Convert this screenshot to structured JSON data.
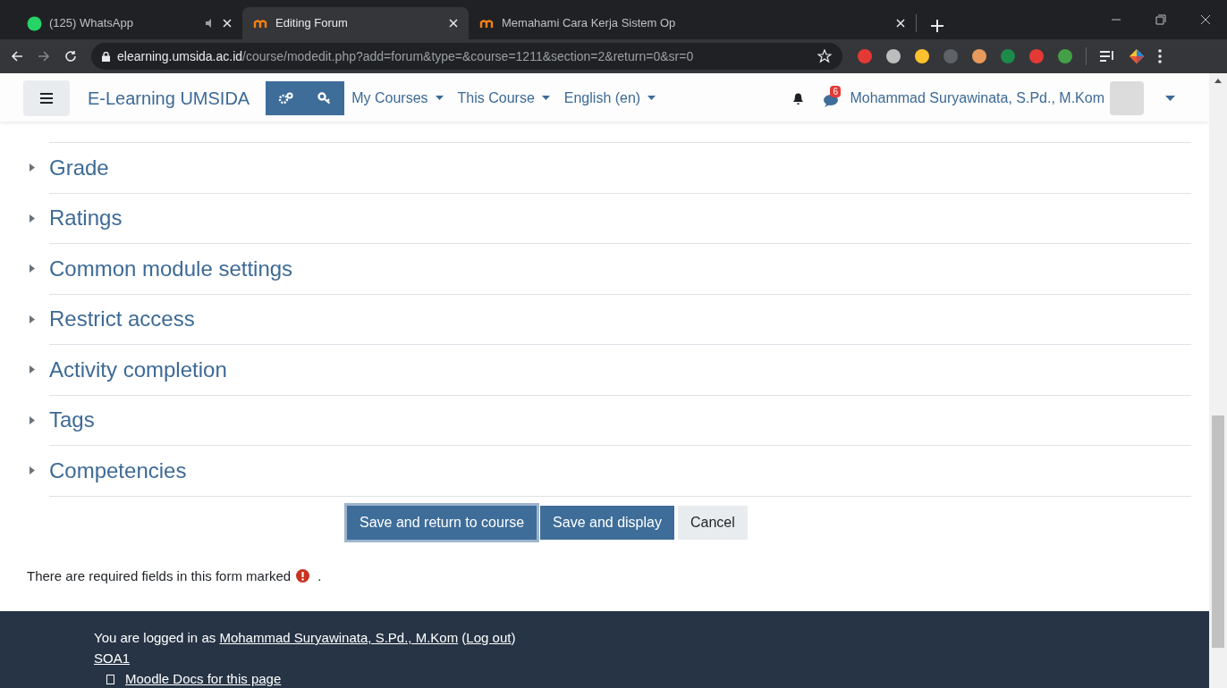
{
  "browser": {
    "tabs": [
      {
        "title": "(125) WhatsApp",
        "selected": false,
        "kind": "whatsapp",
        "muted": true
      },
      {
        "title": "Editing Forum",
        "selected": true,
        "kind": "moodle",
        "muted": false
      },
      {
        "title": "Memahami Cara Kerja Sistem Op",
        "selected": false,
        "kind": "moodle",
        "muted": false
      }
    ],
    "address": {
      "domain": "elearning.umsida.ac.id",
      "path": "/course/modedit.php?add=forum&type=&course=1211&section=2&return=0&sr=0"
    }
  },
  "navbar": {
    "brand": "E-Learning UMSIDA",
    "menus": [
      "My Courses",
      "This Course",
      "English (en)"
    ],
    "message_count": "6",
    "user": "Mohammad Suryawinata, S.Pd., M.Kom"
  },
  "sections": [
    {
      "label": "Grade",
      "expanded": false
    },
    {
      "label": "Ratings",
      "expanded": false
    },
    {
      "label": "Common module settings",
      "expanded": false
    },
    {
      "label": "Restrict access",
      "expanded": false
    },
    {
      "label": "Activity completion",
      "expanded": false
    },
    {
      "label": "Tags",
      "expanded": false
    },
    {
      "label": "Competencies",
      "expanded": false
    }
  ],
  "buttons": [
    {
      "label": "Save and return to course",
      "kind": "primary",
      "focused": true
    },
    {
      "label": "Save and display",
      "kind": "primary",
      "focused": false
    },
    {
      "label": "Cancel",
      "kind": "secondary",
      "focused": false
    }
  ],
  "required_note": {
    "text": "There are required fields in this form marked",
    "end": "."
  },
  "footer": {
    "prefix": "You are logged in as",
    "user_link": "Mohammad Suryawinata, S.Pd., M.Kom",
    "before_logout": "(",
    "logout_link": "Log out",
    "after_logout": ")",
    "course_link": "SOA1",
    "docs_link": "Moodle Docs for this page"
  }
}
